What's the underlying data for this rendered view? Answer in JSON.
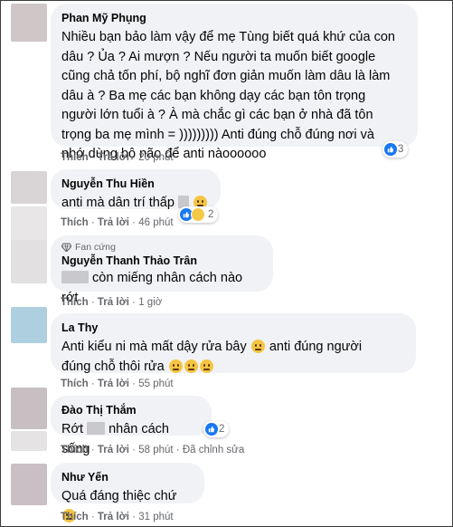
{
  "comments": [
    {
      "name": "Phan Mỹ Phụng",
      "lines": [
        "Nhiều bạn bảo làm vậy để mẹ Tùng biết quá khứ của con",
        "dâu ? Ủa ? Ai mượn ? Nếu người ta muốn biết google",
        "cũng chả tốn phí, bộ nghĩ đơn giản muốn làm dâu là làm",
        "dâu à ? Ba mẹ các bạn không dạy các bạn tôn trọng",
        "người lớn tuổi à ? À mà chắc gì các bạn ở nhà đã tôn",
        "trọng ba mẹ mình = ))))))))) Anti đúng chỗ đúng nơi và",
        "nhớ dùng bộ não để anti nàoooooo"
      ],
      "like": "Thích",
      "reply": "Trả lời",
      "time": "20 phút",
      "reaction_count": "3"
    },
    {
      "name": "Nguyễn Thu Hiền",
      "text": "anti mà dân trí thấp",
      "like": "Thích",
      "reply": "Trả lời",
      "time": "46 phút",
      "reaction_count": "2"
    },
    {
      "badge": "Fan cứng",
      "name": "Nguyễn Thanh Thảo Trân",
      "text": "còn miếng nhân cách nào rớt",
      "like": "Thích",
      "reply": "Trả lời",
      "time": "1 giờ"
    },
    {
      "name": "La Thy",
      "line1_a": "Anti kiểu ni mà mất dậy rửa bây",
      "line1_b": "anti đúng người",
      "line2": "đúng chỗ thôi rửa",
      "like": "Thích",
      "reply": "Trả lời",
      "time": "55 phút"
    },
    {
      "name": "Đào Thị Thắm",
      "text_a": "Rớt",
      "text_b": "nhân cách sống",
      "like": "Thích",
      "reply": "Trả lời",
      "time": "58 phút",
      "edited": "Đã chỉnh sửa",
      "reaction_count": "2"
    },
    {
      "name": "Như Yến",
      "text": "Quá đáng thiệc chứ",
      "like": "Thích",
      "reply": "Trả lời",
      "time": "31 phút"
    }
  ],
  "sep": "·",
  "colors": {
    "bubble": "#f0f2f5",
    "like_blue": "#1877f2",
    "meta_gray": "#65676b"
  },
  "icons": [
    "like-icon",
    "haha-icon",
    "emoji-icon",
    "fan-badge-icon"
  ]
}
